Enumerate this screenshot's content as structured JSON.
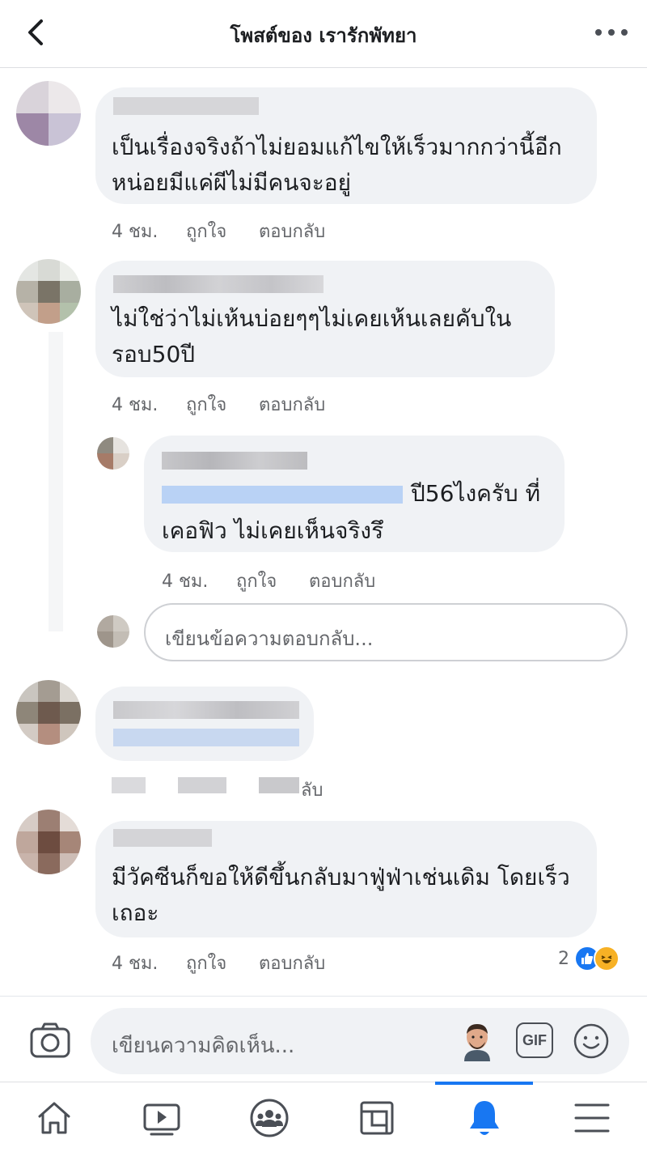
{
  "header": {
    "title": "โพสต์ของ เรารักพัทยา"
  },
  "comments": [
    {
      "lines": [
        "เป็นเรื่องจริงถ้าไม่ยอมแก้ไขให้เร็วมากกว่านี้อีก",
        "หน่อยมีแค่ผีไม่มีคนจะอยู่"
      ],
      "time": "4 ชม.",
      "like": "ถูกใจ",
      "reply": "ตอบกลับ"
    },
    {
      "lines": [
        "ไม่ใช่ว่าไม่เห้นบ่อยๆๆไม่เคยเห้นเลยคับใน",
        "รอบ50ปี"
      ],
      "time": "4 ชม.",
      "like": "ถูกใจ",
      "reply": "ตอบกลับ"
    }
  ],
  "reply": {
    "line1": "ปี56ไงครับ ที่",
    "line2": "เคอฟิว ไม่เคยเห็นจริงรึ",
    "time": "4 ชม.",
    "like": "ถูกใจ",
    "reply": "ตอบกลับ"
  },
  "reply_input": {
    "placeholder": "เขียนข้อความตอบกลับ..."
  },
  "comment3_meta_tail": "ลับ",
  "comment4": {
    "lines": [
      "มีวัคซีนก็ขอให้ดีขึ้นกลับมาฟู่ฟ่าเช่นเดิม โดยเร็ว",
      "เถอะ"
    ],
    "time": "4 ชม.",
    "like": "ถูกใจ",
    "reply": "ตอบกลับ",
    "reaction_count": "2",
    "reactions": [
      "like-icon",
      "haha-icon"
    ]
  },
  "composer": {
    "placeholder": "เขียนความคิดเห็น...",
    "gif_label": "GIF"
  },
  "bottom_nav": [
    "home-icon",
    "watch-icon",
    "groups-icon",
    "pages-icon",
    "notifications-icon",
    "menu-icon"
  ],
  "colors": {
    "accent": "#1877f2",
    "bubble": "#f0f2f5",
    "meta_text": "#65676b"
  }
}
